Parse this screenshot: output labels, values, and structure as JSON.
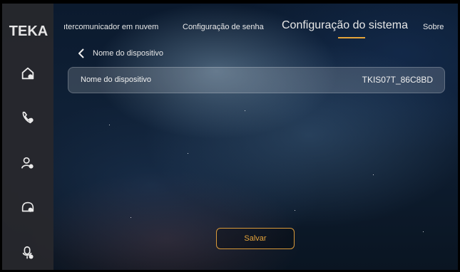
{
  "sidebar": {
    "logo": "TEKA",
    "items": [
      {
        "icon": "home-icon"
      },
      {
        "icon": "call-icon"
      },
      {
        "icon": "users-icon"
      },
      {
        "icon": "monitor-icon"
      },
      {
        "icon": "settings-user-icon"
      }
    ]
  },
  "tabs": [
    {
      "label": "ıtercomunicador em nuvem",
      "active": false
    },
    {
      "label": "Configuração de senha",
      "active": false
    },
    {
      "label": "Configuração do sistema",
      "active": true
    },
    {
      "label": "Sobre",
      "active": false
    }
  ],
  "page": {
    "back_label": "Nome do dispositivo"
  },
  "device": {
    "label": "Nome do dispositivo",
    "value": "TKIS07T_86C8BD"
  },
  "actions": {
    "save_label": "Salvar"
  },
  "colors": {
    "accent": "#e5a43a",
    "sidebar_bg": "#28282c"
  }
}
